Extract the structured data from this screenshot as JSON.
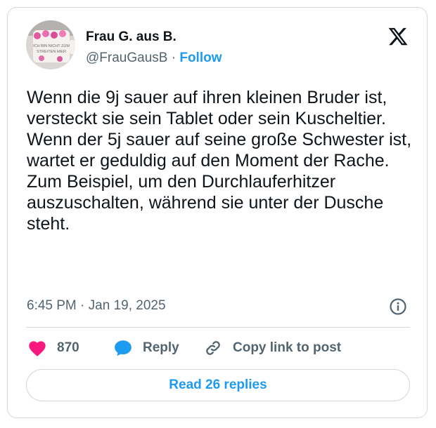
{
  "author": {
    "name": "Frau G. aus B.",
    "handle": "@FrauGausB",
    "separator": "·",
    "follow_label": "Follow",
    "avatar_text_line1": "ICH BIN NICHT ZUM",
    "avatar_text_line2": "STREITEN HIER"
  },
  "tweet": {
    "paragraphs": [
      "Wenn die 9j sauer auf ihren kleinen Bruder ist, versteckt sie sein Tablet oder sein Kuscheltier.",
      "Wenn der 5j sauer auf seine große Schwester ist, wartet er geduldig auf den Moment der Rache. Zum Beispiel, um den Durchlauferhitzer auszuschalten, während sie unter der Dusche steht."
    ],
    "time": "6:45 PM",
    "meta_separator": "·",
    "date": "Jan 19, 2025"
  },
  "actions": {
    "like_count": "870",
    "reply_label": "Reply",
    "copy_link_label": "Copy link to post"
  },
  "read_replies_label": "Read 26 replies",
  "icons": {
    "logo": "x-logo-icon",
    "info": "info-icon",
    "like": "heart-icon",
    "reply": "speech-bubble-icon",
    "copy": "link-icon"
  },
  "colors": {
    "accent": "#1d9bf0",
    "like": "#f91880",
    "text": "#0f1419",
    "muted": "#536471",
    "border": "#cfd9de"
  }
}
